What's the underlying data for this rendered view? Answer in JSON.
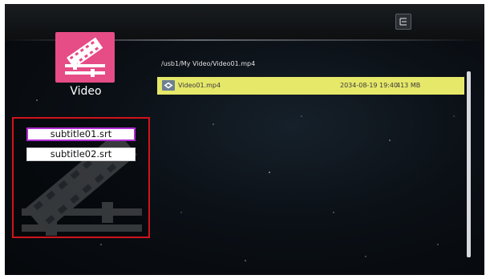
{
  "category": {
    "label": "Video",
    "icon": "film-reel-icon",
    "tile_color": "#e64c86"
  },
  "top_bar": {
    "menu_icon": "menu-icon"
  },
  "subtitle_panel": {
    "border_color": "#d0131b",
    "selected_border_color": "#b12cd3",
    "items": [
      {
        "label": "subtitle01.srt",
        "selected": true
      },
      {
        "label": "subtitle02.srt",
        "selected": false
      }
    ]
  },
  "browser": {
    "path": "/usb1/My Video/Video01.mp4",
    "highlight_color": "#e6e86a",
    "files": [
      {
        "icon": "video-file-icon",
        "name": "Video01.mp4",
        "date": "2034-08-19 19:40",
        "size": "413 MB"
      }
    ]
  }
}
